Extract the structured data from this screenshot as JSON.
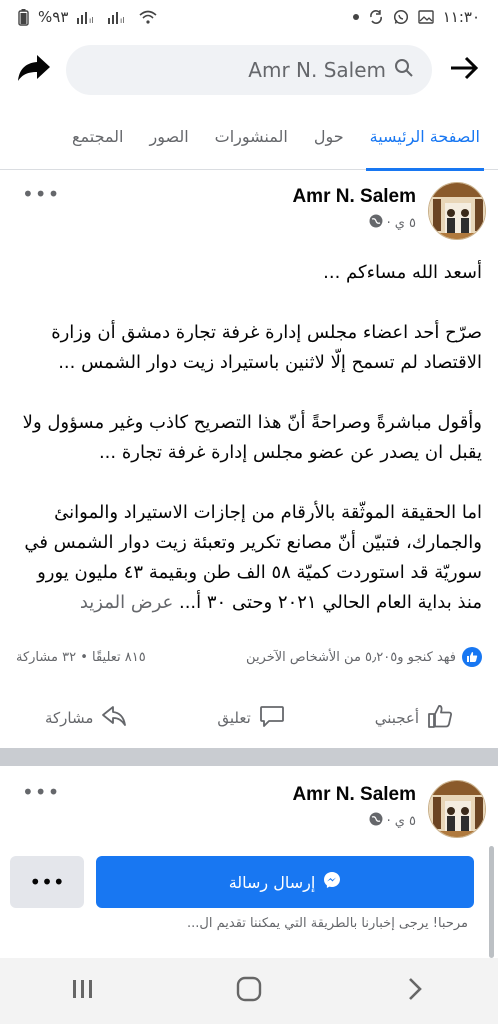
{
  "status_bar": {
    "time": "١١:٣٠",
    "battery": "%٩٣"
  },
  "header": {
    "search_text": "Amr N. Salem"
  },
  "tabs": [
    {
      "label": "الصفحة الرئيسية",
      "active": true
    },
    {
      "label": "حول",
      "active": false
    },
    {
      "label": "المنشورات",
      "active": false
    },
    {
      "label": "الصور",
      "active": false
    },
    {
      "label": "المجتمع",
      "active": false
    }
  ],
  "post": {
    "author": "Amr N. Salem",
    "time": "٥ ي",
    "more": "•••",
    "paragraphs": [
      "أسعد الله مساءكم ...",
      "صرّح أحد اعضاء مجلس إدارة غرفة تجارة دمشق أن وزارة الاقتصاد لم تسمح إلّا لاثنين باستيراد زيت دوار الشمس ...",
      "وأقول مباشرةً وصراحةً أنّ هذا التصريح كاذب وغير مسؤول ولا يقبل ان يصدر عن عضو مجلس إدارة غرفة تجارة ...",
      "اما الحقيقة الموثّقة بالأرقام من إجازات الاستيراد والموانئ والجمارك، فتبيّن أنّ مصانع تكرير وتعبئة زيت دوار الشمس في سوريّة قد استوردت كميّة ٥٨ الف طن وبقيمة ٤٣ مليون يورو منذ بداية العام الحالي ٢٠٢١ وحتى ٣٠ أ..."
    ],
    "see_more": "عرض المزيد",
    "reactions_text": "فهد كنجو و٥٫٢٠٥ من الأشخاص الآخرين",
    "counts_text": "٨١٥ تعليقًا • ٣٢ مشاركة",
    "actions": {
      "like": "أعجبني",
      "comment": "تعليق",
      "share": "مشاركة"
    }
  },
  "post2": {
    "author": "Amr N. Salem",
    "time": "٥ ي",
    "more": "•••",
    "cta_label": "إرسال رسالة",
    "cta_more": "•••",
    "greeting": "مرحبا! يرجى إخبارنا بالطريقة التي يمكننا تقديم ال..."
  },
  "colors": {
    "accent": "#1877f2",
    "muted": "#65676b",
    "divider": "#c9ccd1"
  }
}
